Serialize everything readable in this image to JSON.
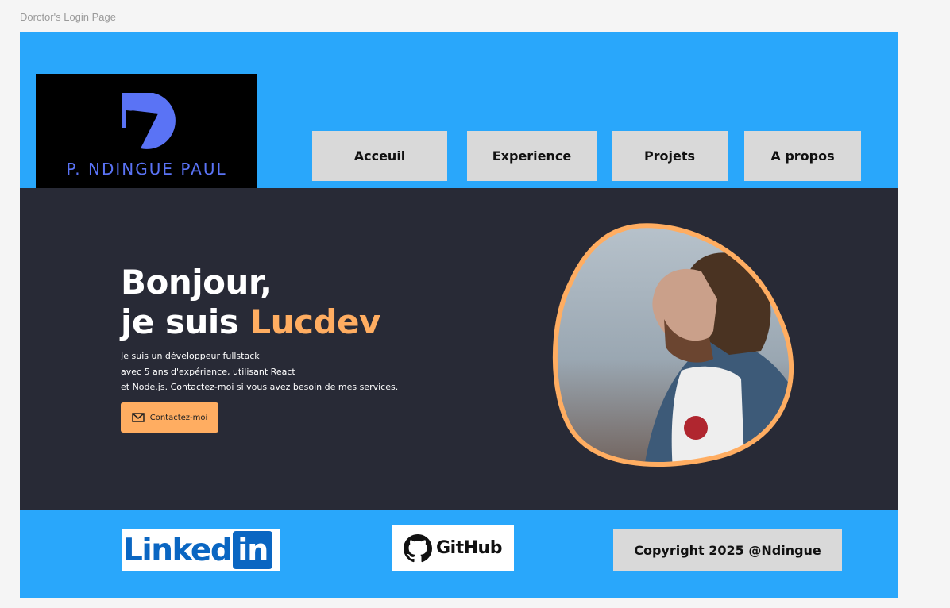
{
  "frame": {
    "label": "Dorctor's Login Page"
  },
  "header": {
    "logo_text": "P. NDINGUE PAUL",
    "nav": [
      {
        "label": "Acceuil"
      },
      {
        "label": "Experience"
      },
      {
        "label": "Projets"
      },
      {
        "label": "A propos"
      }
    ]
  },
  "hero": {
    "greeting": "Bonjour,",
    "intro_prefix": "je suis ",
    "name": "Lucdev",
    "description_lines": [
      "Je suis un développeur fullstack",
      "avec 5 ans d'expérience, utilisant React",
      "et Node.js. Contactez-moi si vous avez besoin de mes services."
    ],
    "contact_button": "Contactez-moi"
  },
  "footer": {
    "linkedin_text": "Linked",
    "linkedin_box": "in",
    "github_text": "GitHub",
    "copyright": "Copyright 2025 @Ndingue"
  },
  "colors": {
    "header_bg": "#29a7fb",
    "hero_bg": "#282a36",
    "accent": "#ffad61",
    "logo_blue": "#5a73f5",
    "linkedin_blue": "#0a66c2",
    "button_gray": "#d9d9d9"
  },
  "icons": {
    "logo": "p-monogram-icon",
    "contact": "envelope-icon",
    "github": "github-octocat-icon"
  }
}
